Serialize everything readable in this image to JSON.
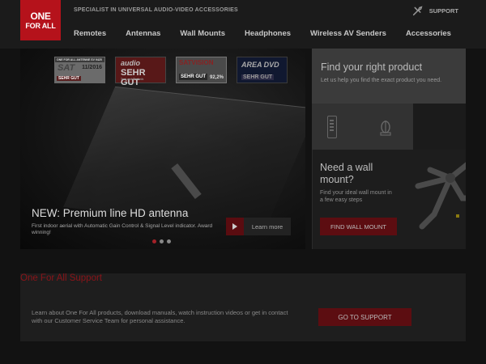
{
  "brand": {
    "logo_line1": "ONE",
    "logo_line2": "FOR ALL",
    "tagline": "SPECIALIST IN UNIVERSAL AUDIO-VIDEO ACCESSORIES",
    "accent_color": "#b5121b"
  },
  "header": {
    "support_label": "SUPPORT",
    "support_icon": "wrench-icon"
  },
  "nav": {
    "items": [
      "Remotes",
      "Antennas",
      "Wall Mounts",
      "Headphones",
      "Wireless AV Senders",
      "Accessories"
    ]
  },
  "hero": {
    "badges": {
      "sat": {
        "top": "ONE FOR ALL ANTENNE SV 9425",
        "brand": "SAT",
        "date": "11/2016",
        "grade": "SEHR GUT"
      },
      "audio": {
        "brand": "audio",
        "grade": "SEHR GUT",
        "sub": "Test und Technik"
      },
      "smv": {
        "brand": "SATVISION",
        "grade": "SEHR GUT",
        "pct": "92,2%"
      },
      "area": {
        "brand": "AREA DVD",
        "grade": "SEHR GUT"
      }
    },
    "title": "NEW: Premium line HD antenna",
    "description": "First indoor aerial with Automatic Gain Control & Signal Level indicator. Award winning!",
    "learn_more": "Learn more",
    "slides": 3,
    "active_slide": 1
  },
  "finder": {
    "title": "Find your right product",
    "subtitle": "Let us help you find the exact product you need.",
    "icons": [
      "remote-icon",
      "antenna-icon"
    ]
  },
  "wall_mount": {
    "title": "Need a wall mount?",
    "subtitle": "Find your ideal wall mount in a few easy steps",
    "button": "FIND WALL MOUNT"
  },
  "support": {
    "title": "One For All Support",
    "description": "Learn about One For All products, download manuals, watch instruction videos or get in contact with our Customer Service Team for personal assistance.",
    "button": "GO TO SUPPORT"
  }
}
